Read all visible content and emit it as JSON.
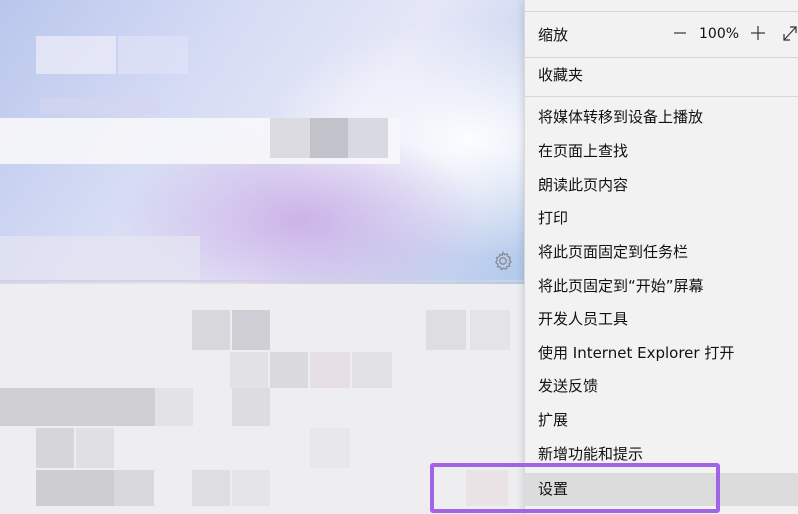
{
  "background": {
    "gear_icon": "gear-icon"
  },
  "menu": {
    "zoom": {
      "label": "缩放",
      "minus": "—",
      "value": "100%",
      "plus": "+",
      "fullscreen_icon": "fullscreen-icon"
    },
    "favorites": "收藏夹",
    "items": [
      {
        "label": "将媒体转移到设备上播放"
      },
      {
        "label": "在页面上查找"
      },
      {
        "label": "朗读此页内容"
      },
      {
        "label": "打印"
      },
      {
        "label": "将此页面固定到任务栏"
      },
      {
        "label": "将此页固定到“开始”屏幕"
      },
      {
        "label": "开发人员工具"
      },
      {
        "label": "使用 Internet Explorer 打开"
      },
      {
        "label": "发送反馈"
      },
      {
        "label": "扩展"
      },
      {
        "label": "新增功能和提示"
      },
      {
        "label": "设置"
      }
    ]
  },
  "colors": {
    "highlight_border": "#a065e6",
    "menu_bg": "#f2f2f2",
    "hover_bg": "#dcdcdc"
  }
}
